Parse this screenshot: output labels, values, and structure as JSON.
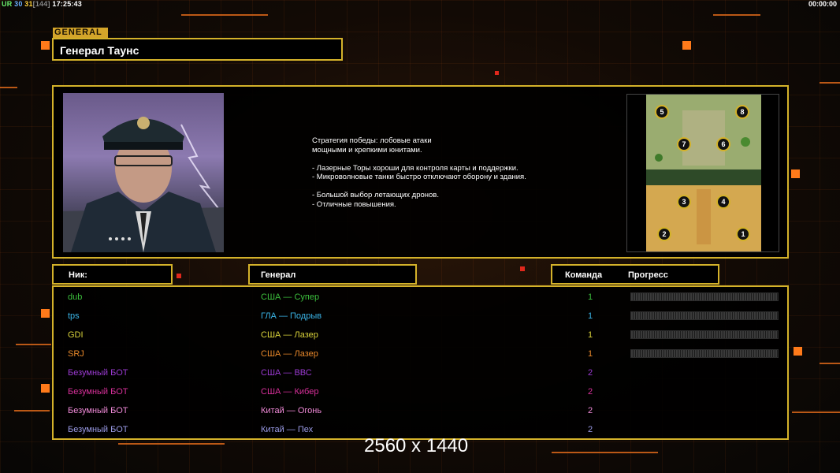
{
  "status": {
    "ur": "UR",
    "n1": "30",
    "n2": "31",
    "n3": "[144]",
    "clock": "17:25:43",
    "timer": "00:00:00"
  },
  "general": {
    "tag": "GENERAL",
    "name": "Генерал Таунс"
  },
  "description": [
    "Стратегия победы: лобовые атаки",
    "мощными и крепкими юнитами.",
    "",
    "- Лазерные Торы хороши для контроля карты и поддержки.",
    "- Микроволновые танки быстро отключают оборону и здания.",
    "",
    "- Большой выбор летающих дронов.",
    "- Отличные повышения."
  ],
  "map": {
    "start_positions": [
      "1",
      "2",
      "3",
      "4",
      "5",
      "6",
      "7",
      "8"
    ]
  },
  "headers": {
    "nick": "Ник:",
    "general": "Генерал",
    "team": "Команда",
    "progress": "Прогресс"
  },
  "players": [
    {
      "nick": "dub",
      "general": "США — Супер",
      "team": "1",
      "color": "#3cbf3c",
      "progress_bar": true
    },
    {
      "nick": "tps",
      "general": "ГЛА — Подрыв",
      "team": "1",
      "color": "#3ab4e6",
      "progress_bar": true
    },
    {
      "nick": "GDI",
      "general": "США — Лазер",
      "team": "1",
      "color": "#d9d23a",
      "progress_bar": true
    },
    {
      "nick": "SRJ",
      "general": "США — Лазер",
      "team": "1",
      "color": "#e8882a",
      "progress_bar": true
    },
    {
      "nick": "Безумный БОТ",
      "general": "США — ВВС",
      "team": "2",
      "color": "#9a3ad0",
      "progress_bar": false
    },
    {
      "nick": "Безумный БОТ",
      "general": "США — Кибер",
      "team": "2",
      "color": "#d8309a",
      "progress_bar": false
    },
    {
      "nick": "Безумный БОТ",
      "general": "Китай — Огонь",
      "team": "2",
      "color": "#f08ad8",
      "progress_bar": false
    },
    {
      "nick": "Безумный БОТ",
      "general": "Китай — Пех",
      "team": "2",
      "color": "#9a9ae6",
      "progress_bar": false
    }
  ],
  "resolution_text": "2560 x 1440"
}
